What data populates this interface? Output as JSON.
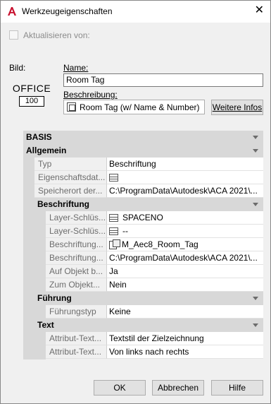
{
  "window": {
    "title": "Werkzeugeigenschaften",
    "app_icon": "autocad-a-icon",
    "close_glyph": "✕"
  },
  "update_checkbox": {
    "label": "Aktualisieren von:",
    "checked": false
  },
  "image": {
    "label": "Bild:",
    "preview_top": "OFFICE",
    "preview_box": "100"
  },
  "name": {
    "label": "Name:",
    "value": "Room Tag"
  },
  "description": {
    "label": "Beschreibung:",
    "value": "Room Tag (w/ Name & Number)",
    "icon": "description-icon"
  },
  "more_info_button": "Weitere Infos",
  "grid": {
    "categories": {
      "basis": "BASIS",
      "allgemein": "Allgemein",
      "beschriftung": "Beschriftung",
      "fuehrung": "Führung",
      "text": "Text"
    },
    "allgemein": [
      {
        "name": "Typ",
        "value": "Beschriftung"
      },
      {
        "name": "Eigenschaftsdat...",
        "value": "",
        "icon": "table-icon"
      },
      {
        "name": "Speicherort der...",
        "value": "C:\\ProgramData\\Autodesk\\ACA 2021\\..."
      }
    ],
    "beschriftung": [
      {
        "name": "Layer-Schlüs...",
        "value": "SPACENO",
        "icon": "table-icon"
      },
      {
        "name": "Layer-Schlüs...",
        "value": "--",
        "icon": "table-icon"
      },
      {
        "name": "Beschriftung...",
        "value": "M_Aec8_Room_Tag",
        "icon": "tag-block-icon"
      },
      {
        "name": "Beschriftung...",
        "value": "C:\\ProgramData\\Autodesk\\ACA 2021\\..."
      },
      {
        "name": "Auf Objekt b...",
        "value": "Ja"
      },
      {
        "name": "Zum Objekt...",
        "value": "Nein"
      }
    ],
    "fuehrung": [
      {
        "name": "Führungstyp",
        "value": "Keine"
      }
    ],
    "text": [
      {
        "name": "Attribut-Text...",
        "value": "Textstil der Zielzeichnung"
      },
      {
        "name": "Attribut-Text...",
        "value": "Von links nach rechts"
      }
    ]
  },
  "buttons": {
    "ok": "OK",
    "cancel": "Abbrechen",
    "help": "Hilfe"
  },
  "colors": {
    "accent_red": "#c8102e",
    "category_bg": "#d8d8d8",
    "muted_text": "#6d6d6d"
  }
}
